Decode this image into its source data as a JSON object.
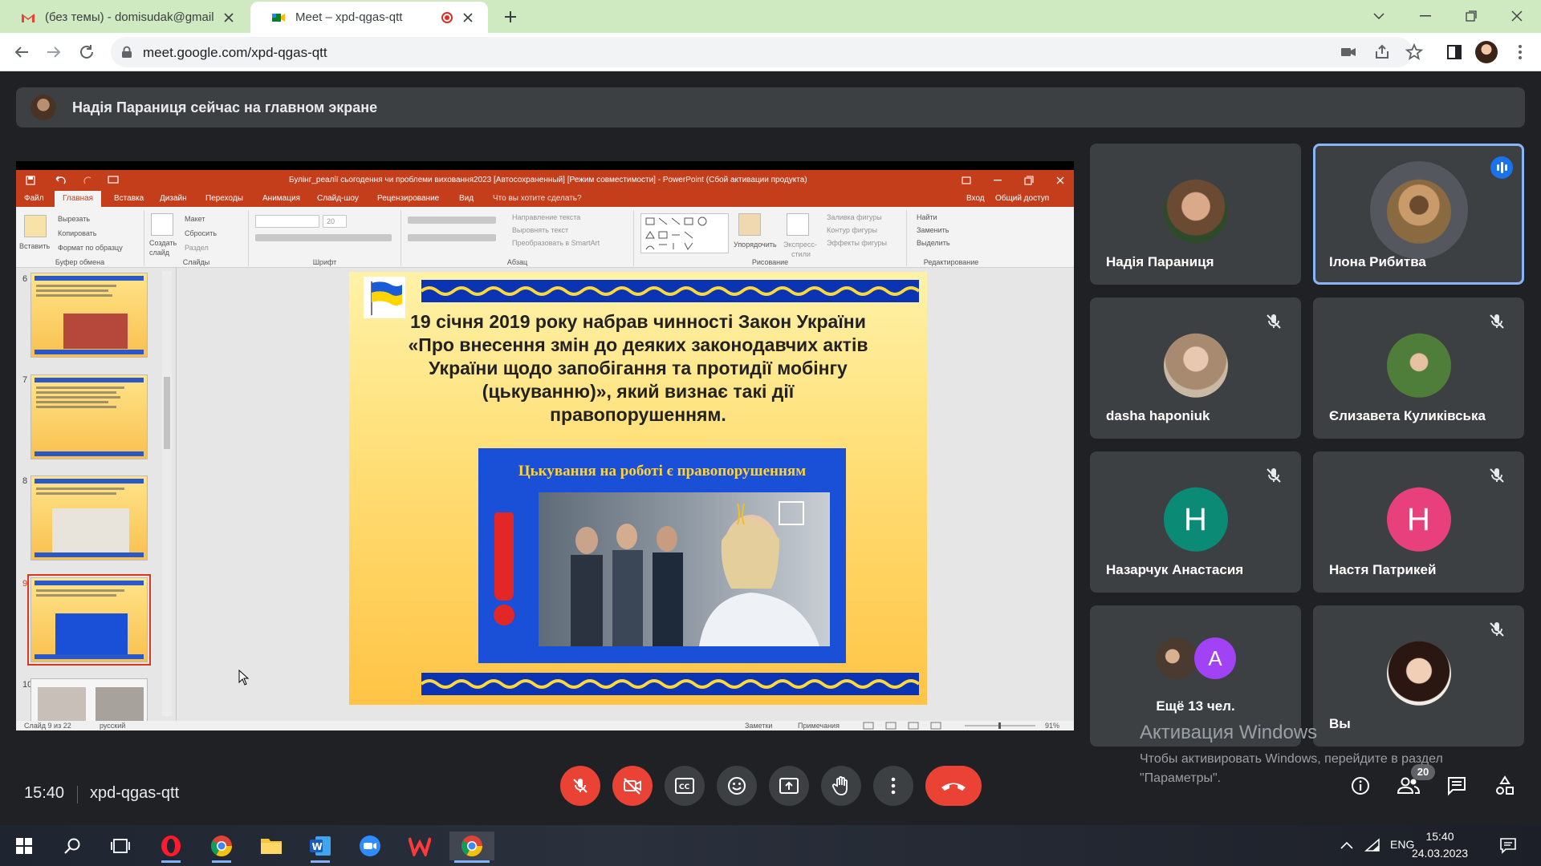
{
  "browser": {
    "tabs": [
      {
        "title": "(без темы) - domisudak@gmail.c",
        "active": false
      },
      {
        "title": "Meet – xpd-qgas-qtt",
        "active": true
      }
    ],
    "url": "meet.google.com/xpd-qgas-qtt"
  },
  "meet": {
    "banner_text": "Надія Параниця сейчас на главном экране",
    "time": "15:40",
    "meeting_code": "xpd-qgas-qtt",
    "participant_count": "20",
    "participants": [
      {
        "name": "Надія Параниця",
        "muted": false
      },
      {
        "name": "Ілона Рибитва",
        "muted": false,
        "speaking": true
      },
      {
        "name": "dasha haponiuk",
        "muted": true
      },
      {
        "name": "Єлизавета Куликівська",
        "muted": true
      },
      {
        "name": "Назарчук Анастасия",
        "initial": "Н",
        "color": "#0b8a76",
        "muted": true
      },
      {
        "name": "Настя Патрикей",
        "initial": "Н",
        "color": "#e8407a",
        "muted": true
      },
      {
        "name": "Ещё 13 чел.",
        "initial": "A",
        "color": "#a142f4"
      },
      {
        "name": "Вы",
        "muted": true
      }
    ]
  },
  "ppt": {
    "title": "Булінг_реалії сьогодення чи проблеми виховання2023 [Автосохраненный] [Режим совместимости] - PowerPoint (Сбой активации продукта)",
    "menu": [
      "Файл",
      "Главная",
      "Вставка",
      "Дизайн",
      "Переходы",
      "Анимация",
      "Слайд-шоу",
      "Рецензирование",
      "Вид",
      "Что вы хотите сделать?",
      "Вход",
      "Общий доступ"
    ],
    "ribbon": {
      "clipboard": {
        "label": "Буфер обмена",
        "paste": "Вставить",
        "cut": "Вырезать",
        "copy": "Копировать",
        "format": "Формат по образцу"
      },
      "slides": {
        "label": "Слайды",
        "create": "Создать",
        "slide": "слайд",
        "layout": "Макет",
        "reset": "Сбросить",
        "section": "Раздел"
      },
      "font": {
        "label": "Шрифт",
        "size": "20"
      },
      "paragraph": {
        "label": "Абзац",
        "dir": "Направление текста",
        "align": "Выровнять текст",
        "smartart": "Преобразовать в SmartArt"
      },
      "drawing": {
        "label": "Рисование",
        "arrange": "Упорядочить",
        "express": "Экспресс-",
        "styles": "стили",
        "fill": "Заливка фигуры",
        "outline": "Контур фигуры",
        "effects": "Эффекты фигуры"
      },
      "editing": {
        "label": "Редактирование",
        "find": "Найти",
        "replace": "Заменить",
        "select": "Выделить"
      }
    },
    "thumb_numbers": [
      "6",
      "7",
      "8",
      "9",
      "10"
    ],
    "slide": {
      "text": "19 січня 2019 року набрав чинності Закон України «Про внесення змін до деяких законодавчих актів України щодо запобігання та протидії мобінгу (цькуванню)», який визнає такі дії правопорушенням.",
      "image_caption": "Цькування на роботі є правопорушенням"
    },
    "status": {
      "slide_info": "Слайд 9 из 22",
      "language": "русский",
      "notes": "Заметки",
      "comments": "Примечания",
      "zoom": "91%"
    }
  },
  "windows": {
    "watermark_title": "Активация Windows",
    "watermark_line1": "Чтобы активировать Windows, перейдите в раздел",
    "watermark_line2": "\"Параметры\".",
    "lang": "ENG",
    "time": "15:40",
    "date": "24.03.2023"
  }
}
